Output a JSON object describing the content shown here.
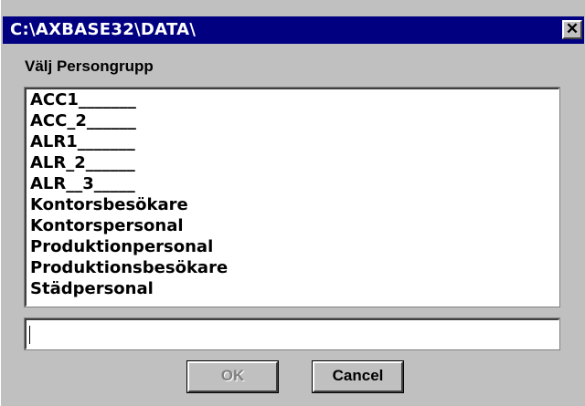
{
  "window": {
    "title": "C:\\AXBASE32\\DATA\\",
    "close_glyph": "✕"
  },
  "dialog": {
    "label": "Välj Persongrupp",
    "list_items": [
      "ACC1_______",
      "ACC_2______",
      "ALR1_______",
      "ALR_2______",
      "ALR__3_____",
      "Kontorsbesökare",
      "Kontorspersonal",
      "Produktionpersonal",
      "Produktionsbesökare",
      "Städpersonal"
    ],
    "input_value": "",
    "ok_label": "OK",
    "cancel_label": "Cancel"
  },
  "colors": {
    "title_bar": "#000080",
    "face": "#c0c0c0",
    "disabled_text": "#808080"
  },
  "icons": {
    "close": "close-icon"
  }
}
